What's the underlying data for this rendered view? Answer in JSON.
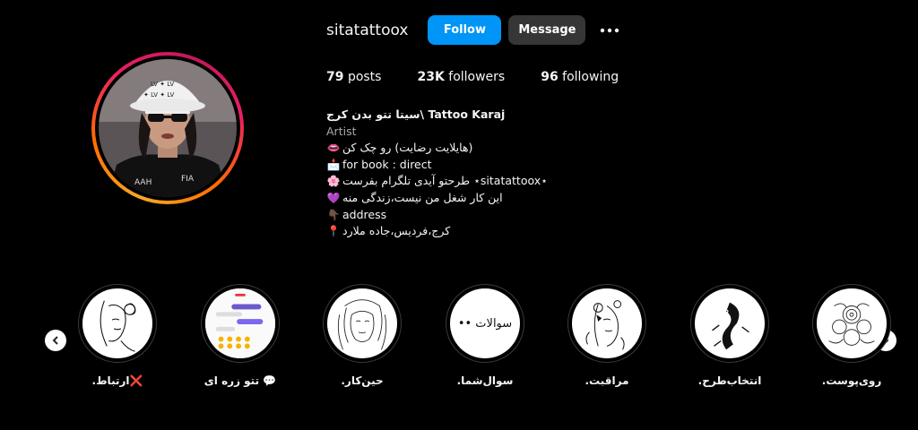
{
  "profile": {
    "username": "sitatattoox",
    "follow_label": "Follow",
    "message_label": "Message",
    "more_icon": "more-options-icon"
  },
  "stats": {
    "posts_count": "79",
    "posts_label": "posts",
    "followers_count": "23K",
    "followers_label": "followers",
    "following_count": "96",
    "following_label": "following"
  },
  "bio": {
    "name": "سیتا تتو بدن کرج\\ Tattoo Karaj",
    "category": "Artist",
    "lines": [
      {
        "emoji": "👄",
        "text": "(هایلایت رضایت) رو چک کن"
      },
      {
        "emoji": "📩",
        "text": "for book : direct"
      },
      {
        "emoji": "🌸",
        "text": "⋆sitatattoox⋆ طرحتو آیدی تلگرام بفرست"
      },
      {
        "emoji": "💜",
        "text": "این کار شغل من نیست،زندگی منه"
      },
      {
        "emoji": "👇🏿",
        "text": "address"
      },
      {
        "emoji": "📍",
        "text": "کرج،فردیس،جاده ملارد"
      }
    ]
  },
  "highlights": [
    {
      "label": ".ارتباط❌",
      "icon": "line-art-face-icon"
    },
    {
      "label": "تتو زره ای 💬",
      "icon": "chat-screenshot-icon"
    },
    {
      "label": ".حین‌کار",
      "icon": "woman-sketch-icon"
    },
    {
      "label": ".سوال‌شما",
      "icon": "questions-text-icon",
      "circle_text": "سوالات ••"
    },
    {
      "label": ".مراقبت",
      "icon": "floral-face-icon"
    },
    {
      "label": ".انتخاب‌طرح",
      "icon": "question-ink-icon"
    },
    {
      "label": ".روی‌پوست",
      "icon": "flower-sketch-icon"
    }
  ],
  "colors": {
    "background": "#000000",
    "follow_button": "#0095f6",
    "message_button": "#363636",
    "secondary_text": "#a8a8a8"
  }
}
